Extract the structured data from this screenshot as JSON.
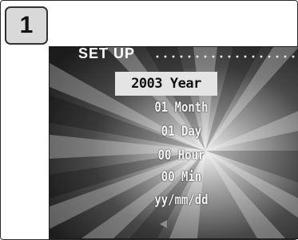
{
  "step": {
    "number": "1"
  },
  "screen": {
    "title": "SET UP",
    "items": [
      {
        "label": "2003 Year",
        "selected": true
      },
      {
        "label": "01 Month",
        "selected": false
      },
      {
        "label": "01 Day",
        "selected": false
      },
      {
        "label": "00 Hour",
        "selected": false
      },
      {
        "label": "00 Min",
        "selected": false
      },
      {
        "label": "yy/mm/dd",
        "selected": false
      }
    ],
    "nav": {
      "left_icon": "left-arrow-icon",
      "right_icon": "right-arrow-icon"
    }
  },
  "colors": {
    "highlight": "#e4e4e4",
    "screen_text": "#f4f4f4",
    "badge_background": "#d9d9d9"
  }
}
